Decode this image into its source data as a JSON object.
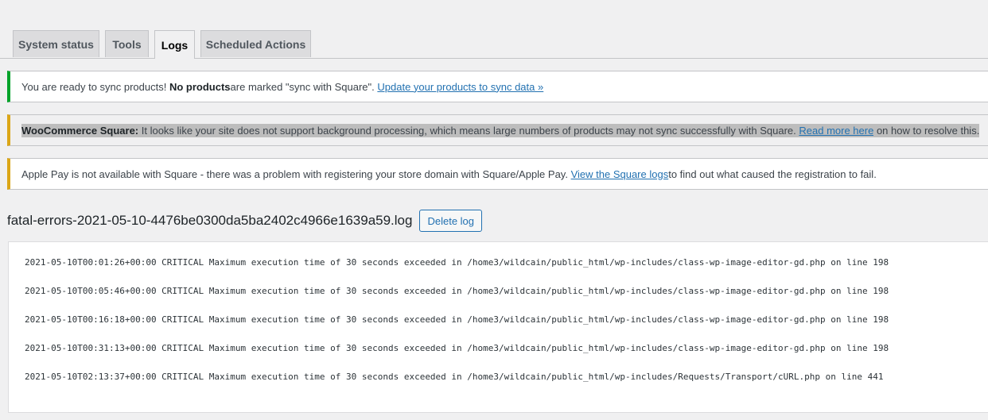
{
  "tabs": [
    {
      "label": "System status",
      "active": false
    },
    {
      "label": "Tools",
      "active": false
    },
    {
      "label": "Logs",
      "active": true
    },
    {
      "label": "Scheduled Actions",
      "active": false
    }
  ],
  "notices": {
    "sync": {
      "text_before": "You are ready to sync products! ",
      "bold": "No products",
      "text_after": " are marked \"sync with Square\". ",
      "link": "Update your products to sync data »"
    },
    "background": {
      "bold": "WooCommerce Square:",
      "text": " It looks like your site does not support background processing, which means large numbers of products may not sync successfully with Square. ",
      "link": "Read more here",
      "text_after": " on how to resolve this."
    },
    "applepay": {
      "text_before": "Apple Pay is not available with Square - there was a problem with registering your store domain with Square/Apple Pay. ",
      "link": "View the Square logs",
      "text_after": " to find out what caused the registration to fail."
    }
  },
  "log": {
    "filename": "fatal-errors-2021-05-10-4476be0300da5ba2402c4966e1639a59.log",
    "delete_label": "Delete log",
    "lines": [
      "2021-05-10T00:01:26+00:00 CRITICAL Maximum execution time of 30 seconds exceeded in /home3/wildcain/public_html/wp-includes/class-wp-image-editor-gd.php on line 198",
      "2021-05-10T00:05:46+00:00 CRITICAL Maximum execution time of 30 seconds exceeded in /home3/wildcain/public_html/wp-includes/class-wp-image-editor-gd.php on line 198",
      "2021-05-10T00:16:18+00:00 CRITICAL Maximum execution time of 30 seconds exceeded in /home3/wildcain/public_html/wp-includes/class-wp-image-editor-gd.php on line 198",
      "2021-05-10T00:31:13+00:00 CRITICAL Maximum execution time of 30 seconds exceeded in /home3/wildcain/public_html/wp-includes/class-wp-image-editor-gd.php on line 198",
      "2021-05-10T02:13:37+00:00 CRITICAL Maximum execution time of 30 seconds exceeded in /home3/wildcain/public_html/wp-includes/Requests/Transport/cURL.php on line 441"
    ]
  },
  "colors": {
    "success": "#00a32a",
    "warning": "#dba617",
    "link": "#2271b1"
  }
}
